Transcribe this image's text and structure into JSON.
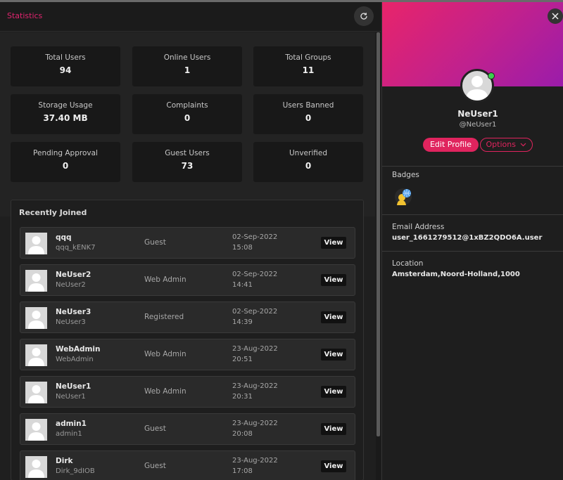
{
  "stats": {
    "title": "Statistics",
    "cards": [
      {
        "label": "Total Users",
        "value": "94"
      },
      {
        "label": "Online Users",
        "value": "1"
      },
      {
        "label": "Total Groups",
        "value": "11"
      },
      {
        "label": "Storage Usage",
        "value": "37.40 MB"
      },
      {
        "label": "Complaints",
        "value": "0"
      },
      {
        "label": "Users Banned",
        "value": "0"
      },
      {
        "label": "Pending Approval",
        "value": "0"
      },
      {
        "label": "Guest Users",
        "value": "73"
      },
      {
        "label": "Unverified",
        "value": "0"
      }
    ]
  },
  "recent": {
    "title": "Recently Joined",
    "view_label": "View",
    "users": [
      {
        "name": "qqq",
        "handle": "qqq_kENK7",
        "role": "Guest",
        "date": "02-Sep-2022",
        "time": "15:08"
      },
      {
        "name": "NeUser2",
        "handle": "NeUser2",
        "role": "Web Admin",
        "date": "02-Sep-2022",
        "time": "14:41"
      },
      {
        "name": "NeUser3",
        "handle": "NeUser3",
        "role": "Registered",
        "date": "02-Sep-2022",
        "time": "14:39"
      },
      {
        "name": "WebAdmin",
        "handle": "WebAdmin",
        "role": "Web Admin",
        "date": "23-Aug-2022",
        "time": "20:51"
      },
      {
        "name": "NeUser1",
        "handle": "NeUser1",
        "role": "Web Admin",
        "date": "23-Aug-2022",
        "time": "20:31"
      },
      {
        "name": "admin1",
        "handle": "admin1",
        "role": "Guest",
        "date": "23-Aug-2022",
        "time": "20:08"
      },
      {
        "name": "Dirk",
        "handle": "Dirk_9dIOB",
        "role": "Guest",
        "date": "23-Aug-2022",
        "time": "17:08"
      }
    ]
  },
  "profile": {
    "name": "NeUser1",
    "handle": "@NeUser1",
    "edit_label": "Edit Profile",
    "options_label": "Options",
    "badges_label": "Badges",
    "email_label": "Email Address",
    "email_value": "user_1661279512@1xBZ2QDO6A.user",
    "location_label": "Location",
    "location_value": "Amsterdam,Noord-Holland,1000",
    "status": "online",
    "accent_color": "#e0245e"
  }
}
